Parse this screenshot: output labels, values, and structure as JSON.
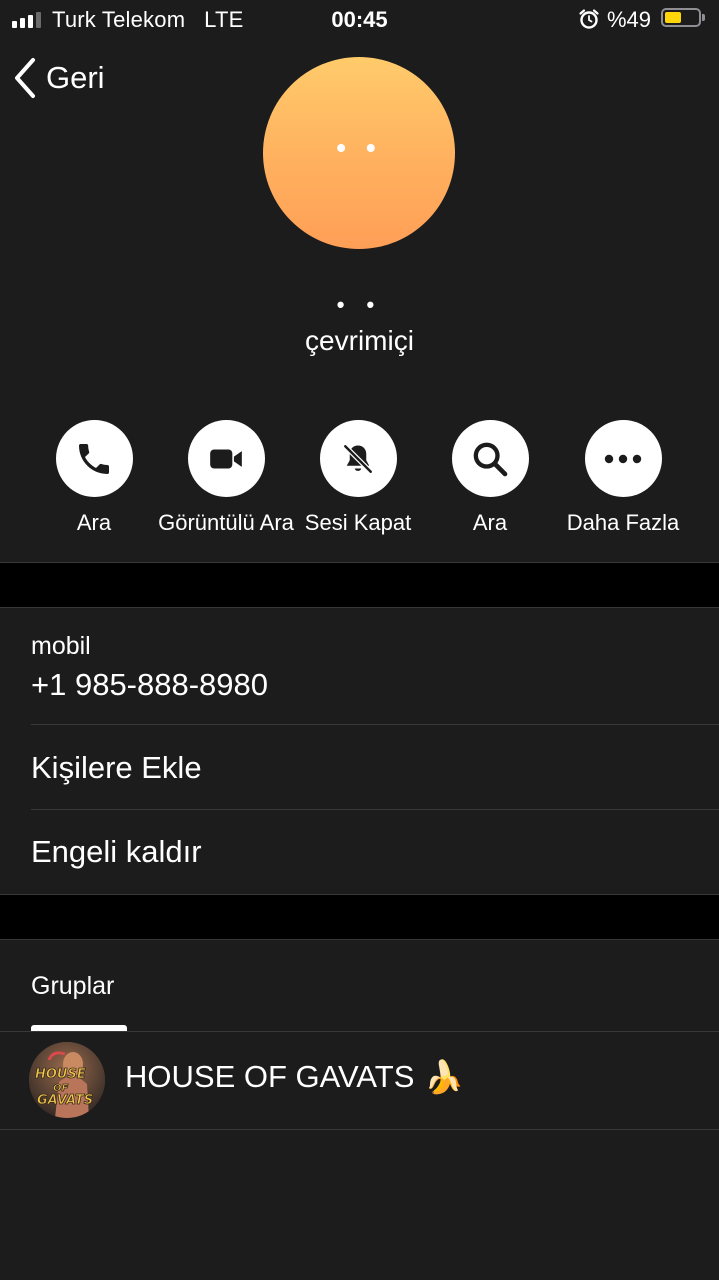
{
  "status_bar": {
    "carrier": "Turk Telekom",
    "network": "LTE",
    "time": "00:45",
    "battery_percent": "%49",
    "battery_level": 0.49,
    "alarm_icon": "alarm-clock-icon"
  },
  "nav": {
    "back_label": "Geri"
  },
  "profile": {
    "avatar_text": "• •",
    "name": "• •",
    "status": "çevrimiçi",
    "avatar_color": "#ffbb63"
  },
  "actions": [
    {
      "label": "Ara",
      "icon": "phone-icon"
    },
    {
      "label": "Görüntülü Ara",
      "icon": "video-camera-icon"
    },
    {
      "label": "Sesi Kapat",
      "icon": "bell-slash-icon"
    },
    {
      "label": "Ara",
      "icon": "magnifier-icon"
    },
    {
      "label": "Daha Fazla",
      "icon": "ellipsis-icon"
    }
  ],
  "info": {
    "phone_label": "mobil",
    "phone_number": "+1 985-888-8980",
    "add_contact": "Kişilere Ekle",
    "unblock": "Engeli kaldır"
  },
  "groups": {
    "title": "Gruplar",
    "items": [
      {
        "name": "HOUSE OF GAVATS",
        "emoji": "🍌",
        "avatar_text": "HOUSE OF GAVATS"
      }
    ]
  }
}
